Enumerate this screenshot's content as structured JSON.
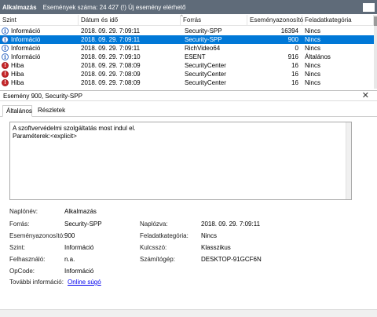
{
  "header": {
    "app_name": "Alkalmazás",
    "event_count": "Események száma: 24 427 (!) Új esemény elérhető"
  },
  "columns": {
    "level": "Szint",
    "date": "Dátum és idő",
    "source": "Forrás",
    "event_id": "Eseményazonosító",
    "category": "Feladatkategória"
  },
  "rows": [
    {
      "icon": "info-icon",
      "level": "Információ",
      "date": "2018. 09. 29. 7:09:11",
      "source": "Security-SPP",
      "id": "16394",
      "category": "Nincs",
      "selected": false
    },
    {
      "icon": "info-icon",
      "level": "Információ",
      "date": "2018. 09. 29. 7:09:11",
      "source": "Security-SPP",
      "id": "900",
      "category": "Nincs",
      "selected": true
    },
    {
      "icon": "info-icon",
      "level": "Információ",
      "date": "2018. 09. 29. 7:09:11",
      "source": "RichVideo64",
      "id": "0",
      "category": "Nincs",
      "selected": false
    },
    {
      "icon": "info-icon",
      "level": "Információ",
      "date": "2018. 09. 29. 7:09:10",
      "source": "ESENT",
      "id": "916",
      "category": "Általános",
      "selected": false
    },
    {
      "icon": "error-icon",
      "level": "Hiba",
      "date": "2018. 09. 29. 7:08:09",
      "source": "SecurityCenter",
      "id": "16",
      "category": "Nincs",
      "selected": false
    },
    {
      "icon": "error-icon",
      "level": "Hiba",
      "date": "2018. 09. 29. 7:08:09",
      "source": "SecurityCenter",
      "id": "16",
      "category": "Nincs",
      "selected": false
    },
    {
      "icon": "error-icon",
      "level": "Hiba",
      "date": "2018. 09. 29. 7:08:09",
      "source": "SecurityCenter",
      "id": "16",
      "category": "Nincs",
      "selected": false
    }
  ],
  "detail": {
    "title": "Esemény 900, Security-SPP",
    "close_label": "✕",
    "tabs": [
      "Általános",
      "Részletek"
    ],
    "message_line1": "A szoftvervédelmi szolgáltatás most indul el.",
    "message_line2": "Paraméterek:<explicit>",
    "labels": {
      "log_name": "Naplónév:",
      "source": "Forrás:",
      "event_id": "Eseményazonosító:",
      "level": "Szint:",
      "user": "Felhasználó:",
      "opcode": "OpCode:",
      "more_info": "További információ:",
      "logged": "Naplózva:",
      "task_category": "Feladatkategória:",
      "keywords": "Kulcsszó:",
      "computer": "Számítógép:"
    },
    "values": {
      "log_name": "Alkalmazás",
      "source": "Security-SPP",
      "event_id": "900",
      "level": "Információ",
      "user": "n.a.",
      "opcode": "Információ",
      "more_info_link": "Online súgó",
      "logged": "2018. 09. 29. 7:09:11",
      "task_category": "Nincs",
      "keywords": "Klasszikus",
      "computer": "DESKTOP-91GCF6N"
    }
  }
}
